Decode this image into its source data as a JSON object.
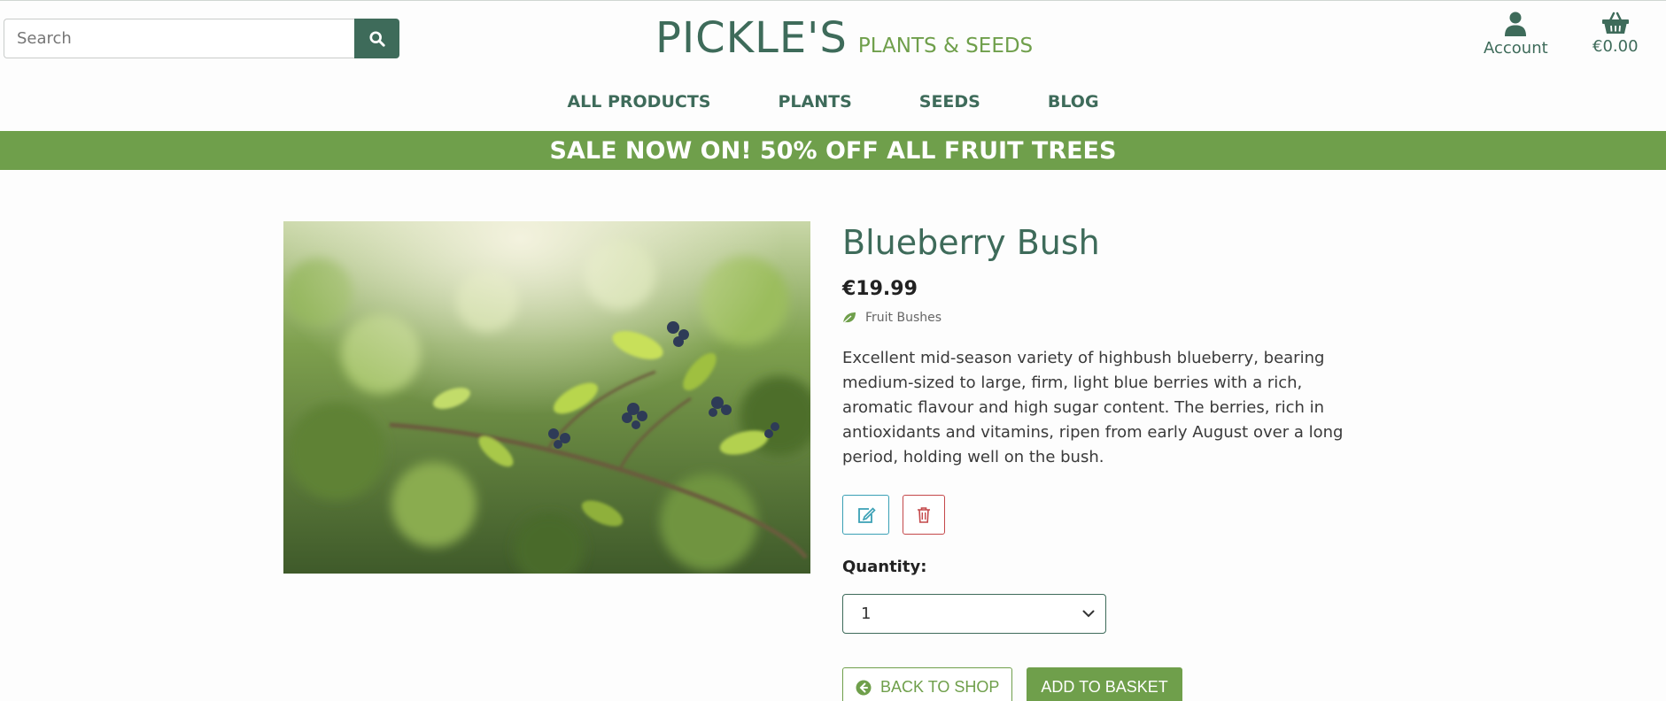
{
  "header": {
    "search": {
      "placeholder": "Search",
      "value": "",
      "button_icon": "search-icon"
    },
    "logo": {
      "main": "PICKLE'S",
      "sub": "PLANTS & SEEDS"
    },
    "account": {
      "label": "Account",
      "icon": "user-icon"
    },
    "basket": {
      "label": "€0.00",
      "icon": "basket-icon"
    }
  },
  "nav": {
    "items": [
      {
        "label": "ALL PRODUCTS"
      },
      {
        "label": "PLANTS"
      },
      {
        "label": "SEEDS"
      },
      {
        "label": "BLOG"
      }
    ]
  },
  "banner": {
    "text": "SALE NOW ON! 50% OFF ALL FRUIT TREES"
  },
  "product": {
    "image_icon": "product-photo",
    "name": "Blueberry Bush",
    "price": "€19.99",
    "category": {
      "label": "Fruit Bushes",
      "icon": "leaf-icon"
    },
    "description": "Excellent mid-season variety of highbush blueberry, bearing medium-sized to large, firm, light blue berries with a rich, aromatic flavour and high sugar content. The berries, rich in antioxidants and vitamins, ripen from early August over a long period, holding well on the bush.",
    "admin": {
      "edit_icon": "edit-icon",
      "delete_icon": "trash-icon"
    },
    "quantity": {
      "label": "Quantity:",
      "selected": "1"
    },
    "buttons": {
      "back": "BACK TO SHOP",
      "back_icon": "arrow-circle-left-icon",
      "add": "ADD TO BASKET"
    }
  },
  "colors": {
    "primary": "#3e6b5a",
    "accent": "#6f9f4b",
    "edit": "#3aa0b5",
    "delete": "#c4484a"
  }
}
